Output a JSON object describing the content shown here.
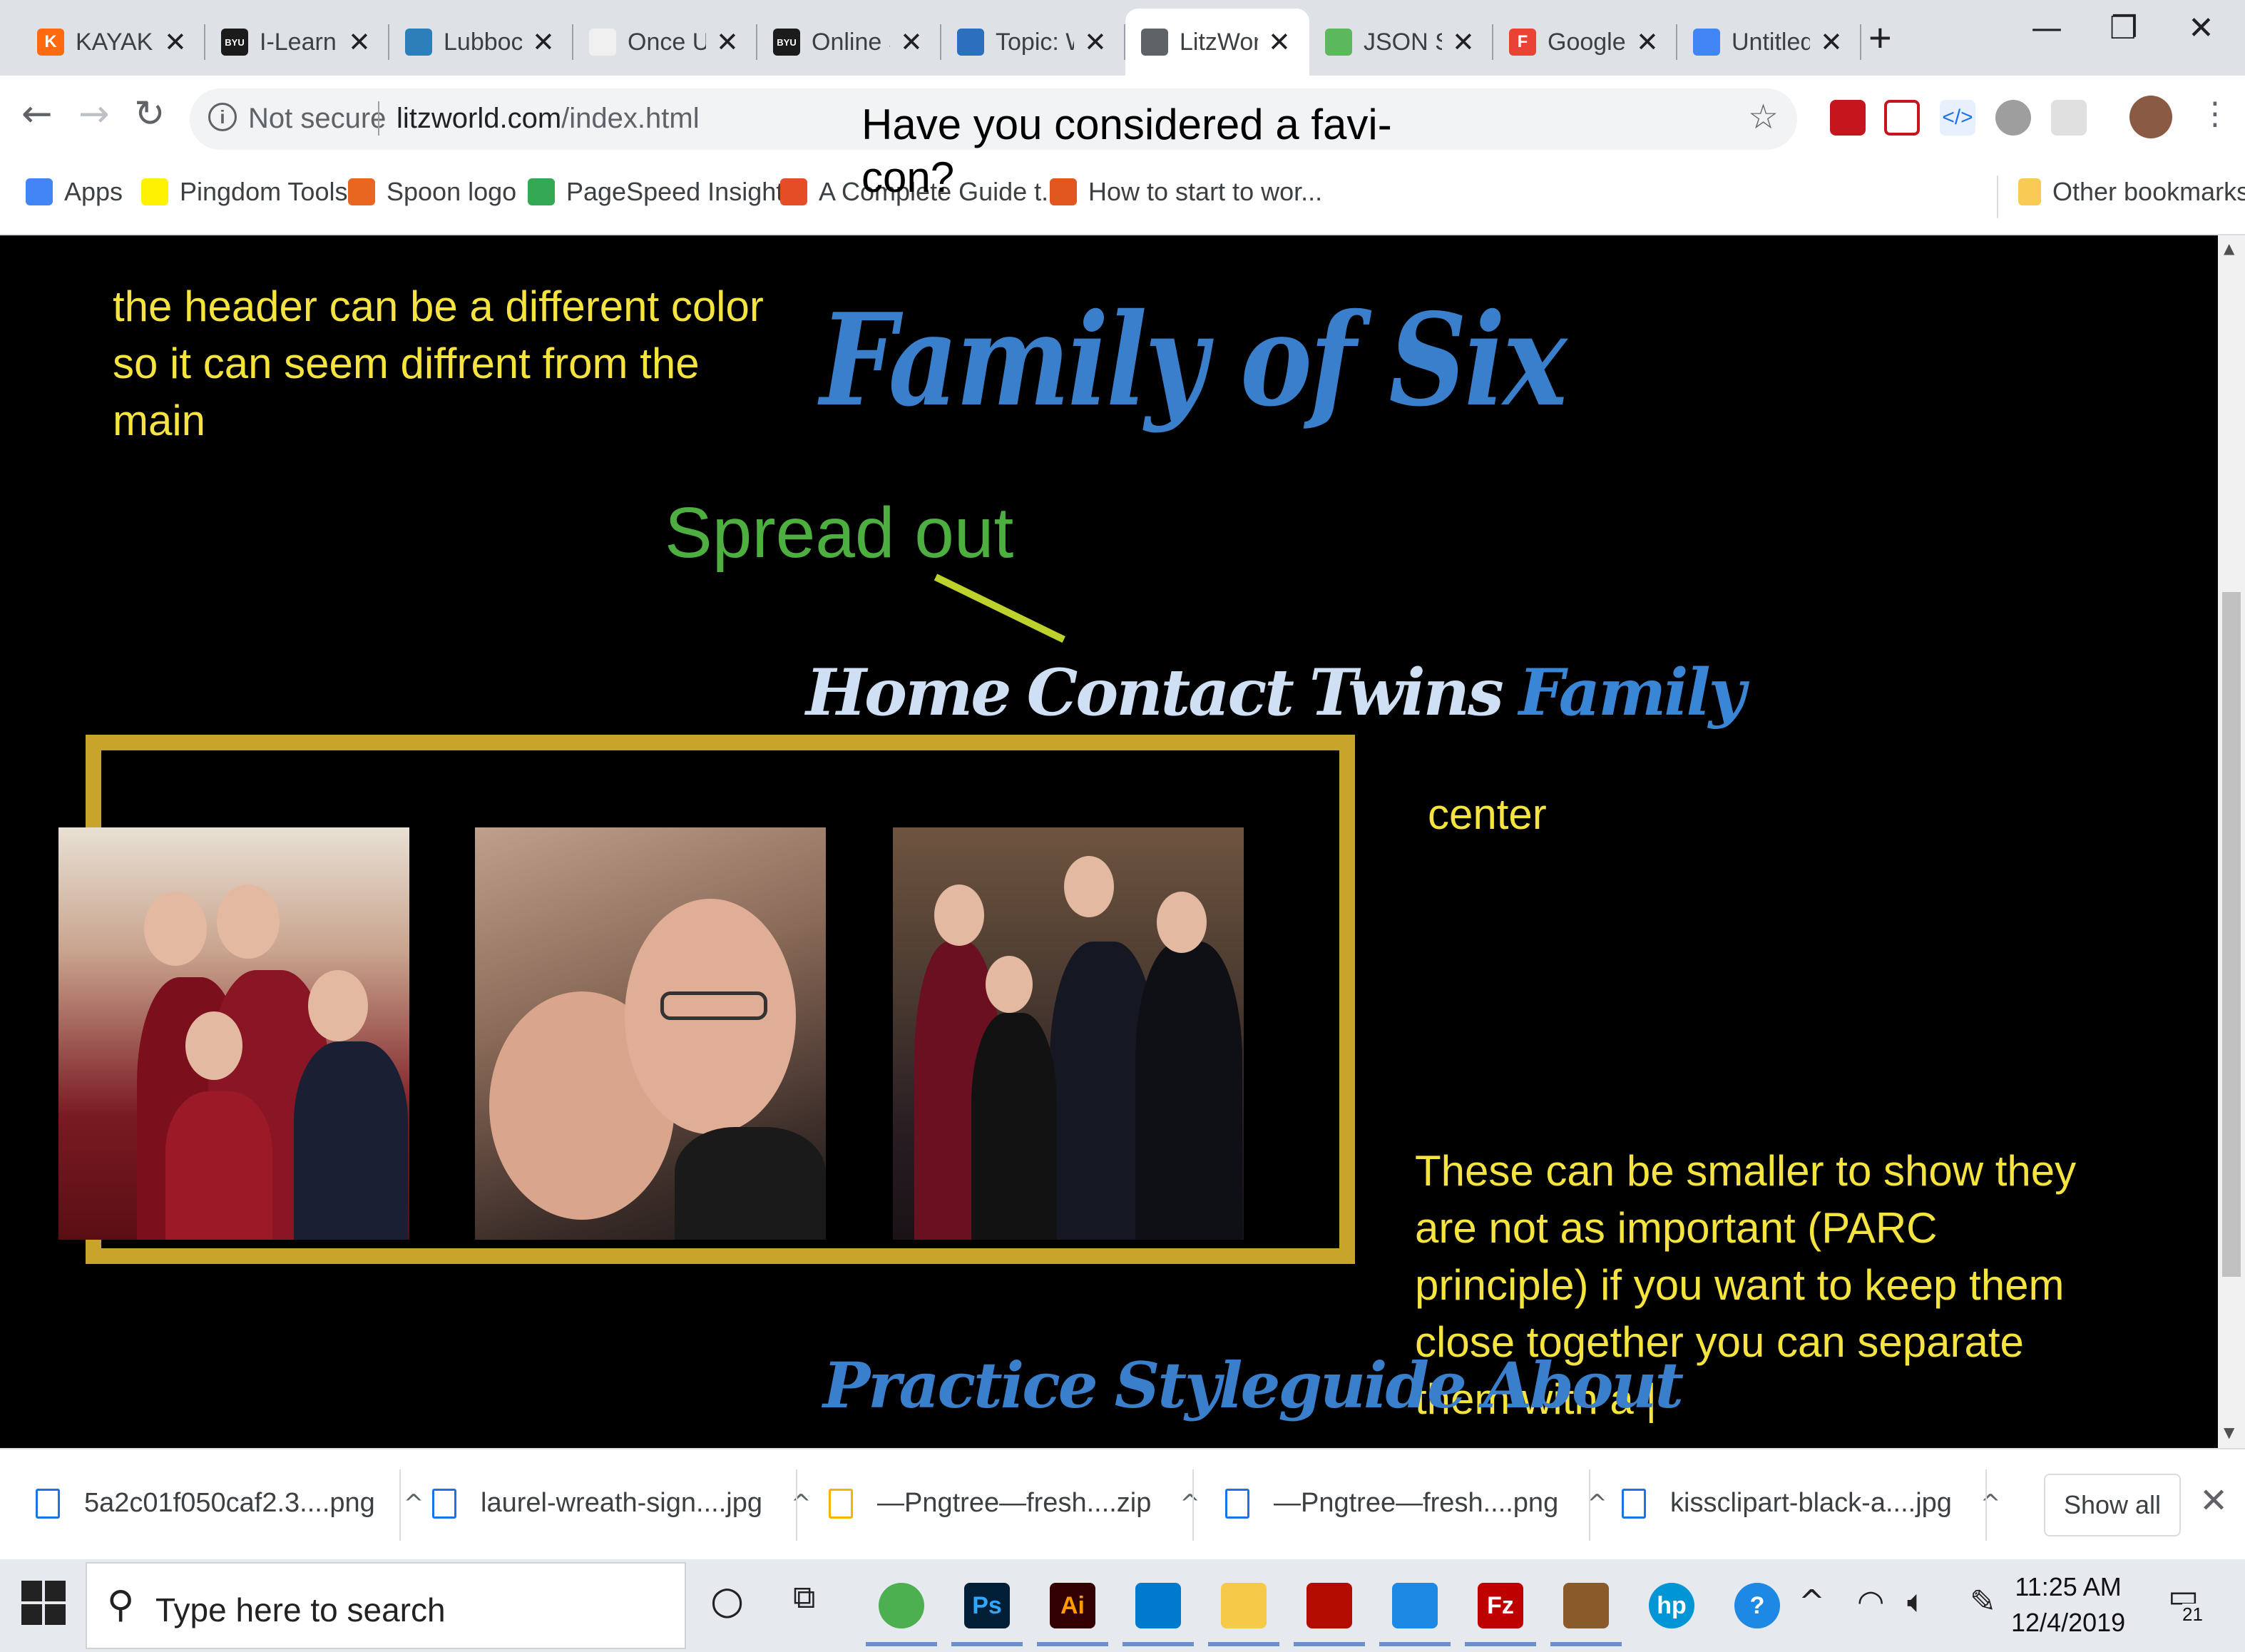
{
  "browser": {
    "tabs": [
      {
        "title": "KAYAK",
        "fav_color": "#ff690f",
        "fav_text": "K",
        "icon": "kayak-icon"
      },
      {
        "title": "I-Learn",
        "fav_color": "#1b1b1b",
        "fav_text": "BYU",
        "icon": "byu-icon"
      },
      {
        "title": "Lubbock",
        "fav_color": "#2c7fb8",
        "fav_text": "",
        "icon": "lubbock-icon"
      },
      {
        "title": "Once U",
        "fav_color": "#f0f0f0",
        "fav_text": "",
        "icon": "once-icon"
      },
      {
        "title": "Online S",
        "fav_color": "#1b1b1b",
        "fav_text": "BYU",
        "icon": "byu-icon"
      },
      {
        "title": "Topic: W",
        "fav_color": "#2c6fbe",
        "fav_text": "",
        "icon": "chart-bars-icon"
      },
      {
        "title": "LitzWor",
        "fav_color": "#5f6368",
        "fav_text": "",
        "icon": "globe-icon",
        "active": true
      },
      {
        "title": "JSON S",
        "fav_color": "#5cb85c",
        "fav_text": "",
        "icon": "json-icon"
      },
      {
        "title": "Google",
        "fav_color": "#ea4335",
        "fav_text": "F",
        "icon": "google-forms-icon"
      },
      {
        "title": "Untitled",
        "fav_color": "#4285f4",
        "fav_text": "",
        "icon": "docs-icon"
      }
    ],
    "omnibox": {
      "security": "Not secure",
      "host": "litzworld.com",
      "path": "/index.html"
    },
    "bookmarks": [
      {
        "label": "Apps",
        "icon": "apps-grid-icon",
        "color": "#4285f4"
      },
      {
        "label": "Pingdom Tools",
        "icon": "pingdom-icon",
        "color": "#fff200"
      },
      {
        "label": "Spoon logo",
        "icon": "spoon-icon",
        "color": "#e8661f"
      },
      {
        "label": "PageSpeed Insights",
        "icon": "pagespeed-icon",
        "color": "#34a853"
      },
      {
        "label": "A Complete Guide t...",
        "icon": "guide-icon",
        "color": "#e44d26"
      },
      {
        "label": "How to start to wor...",
        "icon": "wordpress-icon",
        "color": "#e2561f"
      }
    ],
    "other_bookmarks": "Other bookmarks"
  },
  "annotations": {
    "favicon": "Have you considered a favi-con?",
    "header_color": "the header can be a different color so it can seem diffrent from the main",
    "spread_out": "Spread out",
    "center": "center",
    "smaller": "These can be smaller to show they are not as important (PARC principle) if you want to keep them close together you can separate them with a |"
  },
  "site": {
    "title": "Family of Six",
    "nav": [
      "Home",
      "Contact",
      "Twins",
      "Family"
    ],
    "subnav": [
      "Practice",
      "Styleguide",
      "About"
    ]
  },
  "downloads": {
    "items": [
      {
        "name": "5a2c01f050caf2.3....png",
        "icon": "image-file-icon"
      },
      {
        "name": "laurel-wreath-sign....jpg",
        "icon": "image-file-icon"
      },
      {
        "name": "—Pngtree—fresh....zip",
        "icon": "zip-file-icon"
      },
      {
        "name": "—Pngtree—fresh....png",
        "icon": "image-file-icon"
      },
      {
        "name": "kissclipart-black-a....jpg",
        "icon": "image-file-icon"
      }
    ],
    "show_all": "Show all"
  },
  "taskbar": {
    "search_placeholder": "Type here to search",
    "time": "11:25 AM",
    "date": "12/4/2019",
    "notifications": "21",
    "apps": [
      {
        "name": "chrome-icon",
        "color": "#4caf50",
        "text": "",
        "running": true
      },
      {
        "name": "photoshop-icon",
        "color": "#001e36",
        "text": "Ps",
        "fg": "#31a8ff",
        "running": true
      },
      {
        "name": "illustrator-icon",
        "color": "#330000",
        "text": "Ai",
        "fg": "#ff9a00",
        "running": true
      },
      {
        "name": "vscode-icon",
        "color": "#007acc",
        "text": "",
        "running": true
      },
      {
        "name": "file-explorer-icon",
        "color": "#f7c948",
        "text": "",
        "running": true
      },
      {
        "name": "acrobat-icon",
        "color": "#b30b00",
        "text": "",
        "running": true
      },
      {
        "name": "remote-icon",
        "color": "#1e88e5",
        "text": "",
        "running": true
      },
      {
        "name": "filezilla-icon",
        "color": "#bf0000",
        "text": "Fz",
        "fg": "#fff",
        "running": true
      },
      {
        "name": "photos-icon",
        "color": "#8a5a2b",
        "text": "",
        "running": true
      },
      {
        "name": "hp-icon",
        "color": "#0096d6",
        "text": "hp",
        "fg": "#fff",
        "running": false
      },
      {
        "name": "help-icon",
        "color": "#1e88e5",
        "text": "?",
        "fg": "#fff",
        "running": false
      }
    ]
  }
}
